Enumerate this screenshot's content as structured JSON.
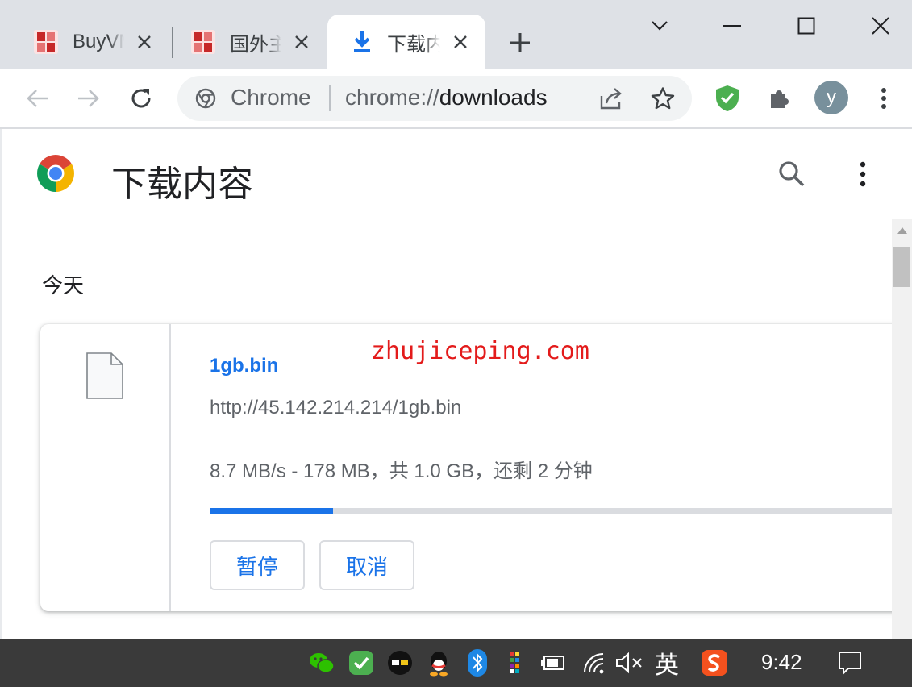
{
  "tabs": [
    {
      "title": "BuyVM",
      "active": false
    },
    {
      "title": "国外主",
      "active": false
    },
    {
      "title": "下载内",
      "active": true
    }
  ],
  "omnibox": {
    "site_chip": "Chrome",
    "url_prefix": "chrome://",
    "url_host": "downloads"
  },
  "profile": {
    "initial": "y"
  },
  "page": {
    "title": "下载内容",
    "section_label": "今天"
  },
  "download": {
    "file_name": "1gb.bin",
    "url": "http://45.142.214.214/1gb.bin",
    "status": "8.7 MB/s - 178 MB，共 1.0 GB，还剩 2 分钟",
    "progress_fraction": 0.178,
    "pause_label": "暂停",
    "cancel_label": "取消"
  },
  "watermark": "zhujiceping.com",
  "taskbar": {
    "ime_label": "英",
    "clock": "9:42"
  },
  "icons": [
    "downloads-tab-icon",
    "back-icon",
    "forward-icon",
    "reload-icon",
    "share-icon",
    "star-icon",
    "shield-extension-icon",
    "puzzle-extension-icon",
    "kebab-menu-icon",
    "search-icon",
    "file-icon",
    "wechat-icon",
    "bluetooth-icon",
    "qq-icon",
    "power-icon",
    "wifi-icon",
    "volume-muted-icon",
    "sogou-icon",
    "notification-icon"
  ],
  "colors": {
    "accent": "#1a73e8",
    "tabstrip": "#dee1e6",
    "taskbar": "#3a3a3a",
    "watermark": "#e31b1b"
  }
}
